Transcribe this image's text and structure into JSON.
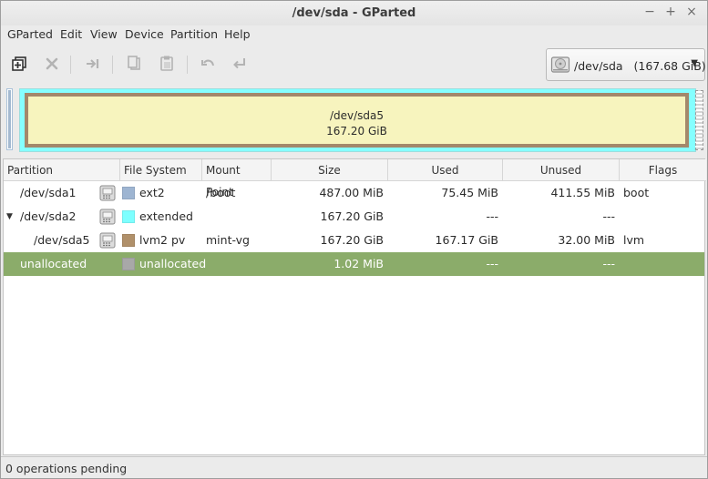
{
  "window": {
    "title": "/dev/sda - GParted"
  },
  "title_buttons": {
    "minimize": "−",
    "maximize": "+",
    "close": "×"
  },
  "menubar": [
    {
      "label": "GParted"
    },
    {
      "label": "Edit"
    },
    {
      "label": "View"
    },
    {
      "label": "Device"
    },
    {
      "label": "Partition"
    },
    {
      "label": "Help"
    }
  ],
  "toolbar": {
    "buttons": [
      {
        "icon": "new-partition-icon"
      },
      {
        "icon": "delete-icon"
      },
      {
        "icon": "resize-move-icon"
      },
      {
        "icon": "copy-icon"
      },
      {
        "icon": "paste-icon"
      },
      {
        "icon": "undo-icon"
      },
      {
        "icon": "apply-icon"
      }
    ],
    "device": {
      "name": "/dev/sda",
      "size": "(167.68 GiB)",
      "icon": "harddisk-icon"
    }
  },
  "disk_map": {
    "partition_label": "/dev/sda5",
    "partition_size": "167.20 GiB"
  },
  "table": {
    "columns": [
      "Partition",
      "File System",
      "Mount Point",
      "Size",
      "Used",
      "Unused",
      "Flags"
    ],
    "rows": [
      {
        "partition": "/dev/sda1",
        "filesystem": "ext2",
        "fs_color": "#9eb5d2",
        "mount": "/boot",
        "size": "487.00 MiB",
        "used": "75.45 MiB",
        "unused": "411.55 MiB",
        "flags": "boot",
        "locked": true
      },
      {
        "partition": "/dev/sda2",
        "filesystem": "extended",
        "fs_color": "#7dffff",
        "mount": "",
        "size": "167.20 GiB",
        "used": "---",
        "unused": "---",
        "flags": "",
        "locked": true,
        "expanded": true
      },
      {
        "partition": "/dev/sda5",
        "filesystem": "lvm2 pv",
        "fs_color": "#b0906a",
        "mount": "mint-vg",
        "size": "167.20 GiB",
        "used": "167.17 GiB",
        "unused": "32.00 MiB",
        "flags": "lvm",
        "locked": true
      },
      {
        "partition": "unallocated",
        "filesystem": "unallocated",
        "fs_color": "#a8a8a8",
        "mount": "",
        "size": "1.02 MiB",
        "used": "---",
        "unused": "---",
        "flags": "",
        "locked": false,
        "selected": true
      }
    ]
  },
  "status": {
    "text": "0 operations pending"
  },
  "colors": {
    "selection": "#8bac6a",
    "extended": "#85ffff",
    "lvm_fill": "#f7f4be",
    "lvm_border": "#a3886b"
  }
}
